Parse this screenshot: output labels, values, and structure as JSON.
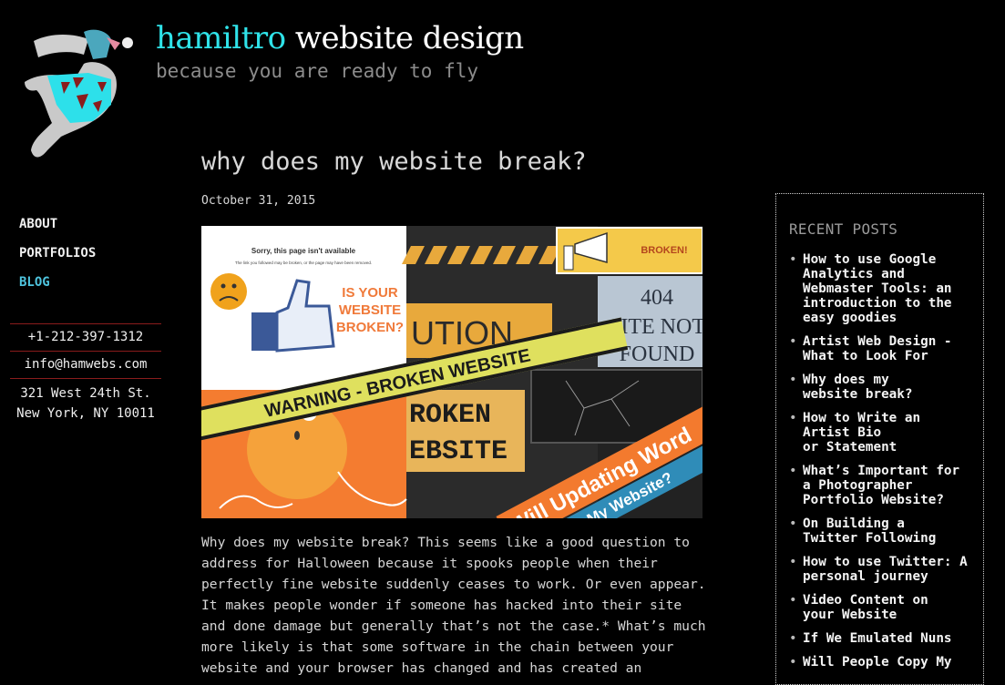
{
  "header": {
    "brand": "hamiltro",
    "title_rest": " website design",
    "tagline": "because you are ready to fly",
    "logo_icon": "flying-rabbit-logo"
  },
  "nav": {
    "items": [
      {
        "label": "ABOUT",
        "active": false
      },
      {
        "label": "PORTFOLIOS",
        "active": false
      },
      {
        "label": "BLOG",
        "active": true
      }
    ]
  },
  "contact": {
    "phone": "+1-212-397-1312",
    "email": "info@hamwebs.com",
    "address_line1": "321 West 24th St.",
    "address_line2": "New York, NY 10011"
  },
  "post": {
    "title": "why does my website break?",
    "date": "October 31, 2015",
    "hero_image": {
      "texts": {
        "sorry": "Sorry, this page isn't available",
        "sorry_sub": "The link you followed may be broken, or the page may have been removed.",
        "is_your": "IS YOUR",
        "website": "WEBSITE",
        "broken_q": "BROKEN?",
        "broken_ex": "BROKEN!",
        "caution": "UTION",
        "warning_tape": "WARNING - BROKEN WEBSITE",
        "code_404": "404",
        "site_not": "SITE NOT",
        "found": "FOUND",
        "roken": "ROKEN",
        "ebsite": "EBSITE",
        "will_update": "Will Updating Word",
        "break_my": "Break My Website?"
      }
    },
    "body": "Why does my website break? This seems like a good question to address for Halloween because it spooks people when their perfectly fine website suddenly ceases to work. Or even appear. It makes people wonder if someone has hacked into their site and done damage but generally that’s not the case.* What’s much more likely is that some software in the chain between your website and your browser has changed and has created an"
  },
  "recent_posts": {
    "heading": "RECENT POSTS",
    "items": [
      "How to use Google\nAnalytics and\nWebmaster Tools: an\nintroduction to the\neasy goodies",
      "Artist Web Design -\nWhat to Look For",
      "Why does my\nwebsite break?",
      "How to Write an\nArtist Bio\nor Statement",
      "What’s Important for\na Photographer\nPortfolio Website?",
      "On Building a\nTwitter Following",
      "How to use Twitter: A\npersonal journey",
      "Video Content on\nyour Website",
      "If We Emulated Nuns",
      "Will People Copy My"
    ]
  },
  "colors": {
    "brand_cyan": "#2fe3e9",
    "nav_active": "#4ec3dd",
    "rule_red": "#8a1c1c",
    "background": "#000000"
  }
}
